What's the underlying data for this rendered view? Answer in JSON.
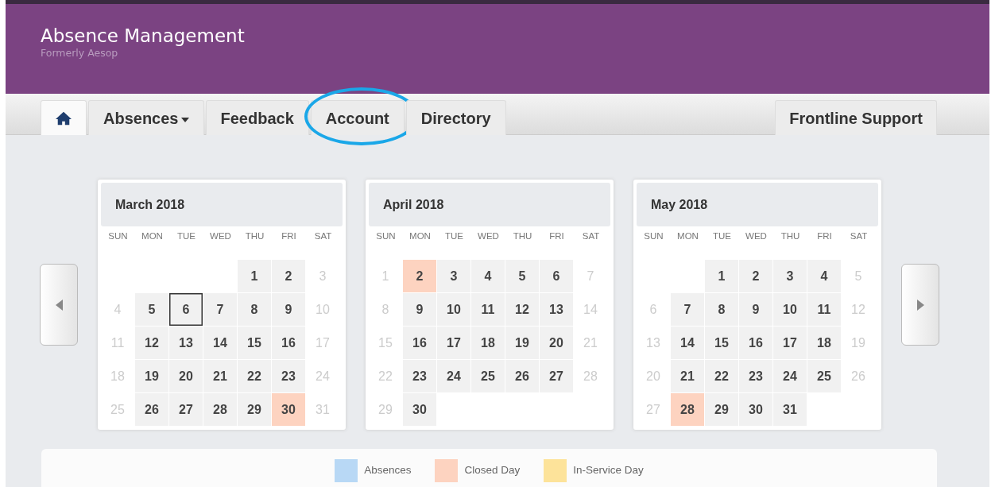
{
  "header": {
    "title": "Absence Management",
    "subtitle": "Formerly Aesop"
  },
  "tabs": [
    {
      "kind": "home",
      "selected": true,
      "circled": false
    },
    {
      "kind": "dropdown",
      "label": "Absences",
      "selected": false,
      "circled": false
    },
    {
      "kind": "text",
      "label": "Feedback",
      "selected": false,
      "circled": false
    },
    {
      "kind": "text",
      "label": "Account",
      "selected": false,
      "circled": true
    },
    {
      "kind": "text",
      "label": "Directory",
      "selected": false,
      "circled": false
    }
  ],
  "support_tab": {
    "label": "Frontline Support"
  },
  "months": [
    {
      "title": "March 2018",
      "weekdays": [
        "SUN",
        "MON",
        "TUE",
        "WED",
        "THU",
        "FRI",
        "SAT"
      ],
      "days": [
        {
          "kind": "empty"
        },
        {
          "kind": "empty"
        },
        {
          "kind": "empty"
        },
        {
          "kind": "empty"
        },
        {
          "text": "1",
          "kind": "workday"
        },
        {
          "text": "2",
          "kind": "workday"
        },
        {
          "text": "3",
          "kind": "weekend"
        },
        {
          "text": "4",
          "kind": "weekend"
        },
        {
          "text": "5",
          "kind": "workday"
        },
        {
          "text": "6",
          "kind": "today"
        },
        {
          "text": "7",
          "kind": "workday"
        },
        {
          "text": "8",
          "kind": "workday"
        },
        {
          "text": "9",
          "kind": "workday"
        },
        {
          "text": "10",
          "kind": "weekend"
        },
        {
          "text": "11",
          "kind": "weekend"
        },
        {
          "text": "12",
          "kind": "workday"
        },
        {
          "text": "13",
          "kind": "workday"
        },
        {
          "text": "14",
          "kind": "workday"
        },
        {
          "text": "15",
          "kind": "workday"
        },
        {
          "text": "16",
          "kind": "workday"
        },
        {
          "text": "17",
          "kind": "weekend"
        },
        {
          "text": "18",
          "kind": "weekend"
        },
        {
          "text": "19",
          "kind": "workday"
        },
        {
          "text": "20",
          "kind": "workday"
        },
        {
          "text": "21",
          "kind": "workday"
        },
        {
          "text": "22",
          "kind": "workday"
        },
        {
          "text": "23",
          "kind": "workday"
        },
        {
          "text": "24",
          "kind": "weekend"
        },
        {
          "text": "25",
          "kind": "weekend"
        },
        {
          "text": "26",
          "kind": "workday"
        },
        {
          "text": "27",
          "kind": "workday"
        },
        {
          "text": "28",
          "kind": "workday"
        },
        {
          "text": "29",
          "kind": "workday"
        },
        {
          "text": "30",
          "kind": "closed"
        },
        {
          "text": "31",
          "kind": "weekend"
        }
      ]
    },
    {
      "title": "April 2018",
      "weekdays": [
        "SUN",
        "MON",
        "TUE",
        "WED",
        "THU",
        "FRI",
        "SAT"
      ],
      "days": [
        {
          "text": "1",
          "kind": "weekend"
        },
        {
          "text": "2",
          "kind": "closed"
        },
        {
          "text": "3",
          "kind": "workday"
        },
        {
          "text": "4",
          "kind": "workday"
        },
        {
          "text": "5",
          "kind": "workday"
        },
        {
          "text": "6",
          "kind": "workday"
        },
        {
          "text": "7",
          "kind": "weekend"
        },
        {
          "text": "8",
          "kind": "weekend"
        },
        {
          "text": "9",
          "kind": "workday"
        },
        {
          "text": "10",
          "kind": "workday"
        },
        {
          "text": "11",
          "kind": "workday"
        },
        {
          "text": "12",
          "kind": "workday"
        },
        {
          "text": "13",
          "kind": "workday"
        },
        {
          "text": "14",
          "kind": "weekend"
        },
        {
          "text": "15",
          "kind": "weekend"
        },
        {
          "text": "16",
          "kind": "workday"
        },
        {
          "text": "17",
          "kind": "workday"
        },
        {
          "text": "18",
          "kind": "workday"
        },
        {
          "text": "19",
          "kind": "workday"
        },
        {
          "text": "20",
          "kind": "workday"
        },
        {
          "text": "21",
          "kind": "weekend"
        },
        {
          "text": "22",
          "kind": "weekend"
        },
        {
          "text": "23",
          "kind": "workday"
        },
        {
          "text": "24",
          "kind": "workday"
        },
        {
          "text": "25",
          "kind": "workday"
        },
        {
          "text": "26",
          "kind": "workday"
        },
        {
          "text": "27",
          "kind": "workday"
        },
        {
          "text": "28",
          "kind": "weekend"
        },
        {
          "text": "29",
          "kind": "weekend"
        },
        {
          "text": "30",
          "kind": "workday"
        }
      ]
    },
    {
      "title": "May 2018",
      "weekdays": [
        "SUN",
        "MON",
        "TUE",
        "WED",
        "THU",
        "FRI",
        "SAT"
      ],
      "days": [
        {
          "kind": "empty"
        },
        {
          "kind": "empty"
        },
        {
          "text": "1",
          "kind": "workday"
        },
        {
          "text": "2",
          "kind": "workday"
        },
        {
          "text": "3",
          "kind": "workday"
        },
        {
          "text": "4",
          "kind": "workday"
        },
        {
          "text": "5",
          "kind": "weekend"
        },
        {
          "text": "6",
          "kind": "weekend"
        },
        {
          "text": "7",
          "kind": "workday"
        },
        {
          "text": "8",
          "kind": "workday"
        },
        {
          "text": "9",
          "kind": "workday"
        },
        {
          "text": "10",
          "kind": "workday"
        },
        {
          "text": "11",
          "kind": "workday"
        },
        {
          "text": "12",
          "kind": "weekend"
        },
        {
          "text": "13",
          "kind": "weekend"
        },
        {
          "text": "14",
          "kind": "workday"
        },
        {
          "text": "15",
          "kind": "workday"
        },
        {
          "text": "16",
          "kind": "workday"
        },
        {
          "text": "17",
          "kind": "workday"
        },
        {
          "text": "18",
          "kind": "workday"
        },
        {
          "text": "19",
          "kind": "weekend"
        },
        {
          "text": "20",
          "kind": "weekend"
        },
        {
          "text": "21",
          "kind": "workday"
        },
        {
          "text": "22",
          "kind": "workday"
        },
        {
          "text": "23",
          "kind": "workday"
        },
        {
          "text": "24",
          "kind": "workday"
        },
        {
          "text": "25",
          "kind": "workday"
        },
        {
          "text": "26",
          "kind": "weekend"
        },
        {
          "text": "27",
          "kind": "weekend"
        },
        {
          "text": "28",
          "kind": "closed"
        },
        {
          "text": "29",
          "kind": "workday"
        },
        {
          "text": "30",
          "kind": "workday"
        },
        {
          "text": "31",
          "kind": "workday"
        }
      ]
    }
  ],
  "legend": [
    {
      "label": "Absences",
      "color": "#b8d8f5"
    },
    {
      "label": "Closed Day",
      "color": "#fdd3c0"
    },
    {
      "label": "In-Service Day",
      "color": "#fde39a"
    }
  ]
}
